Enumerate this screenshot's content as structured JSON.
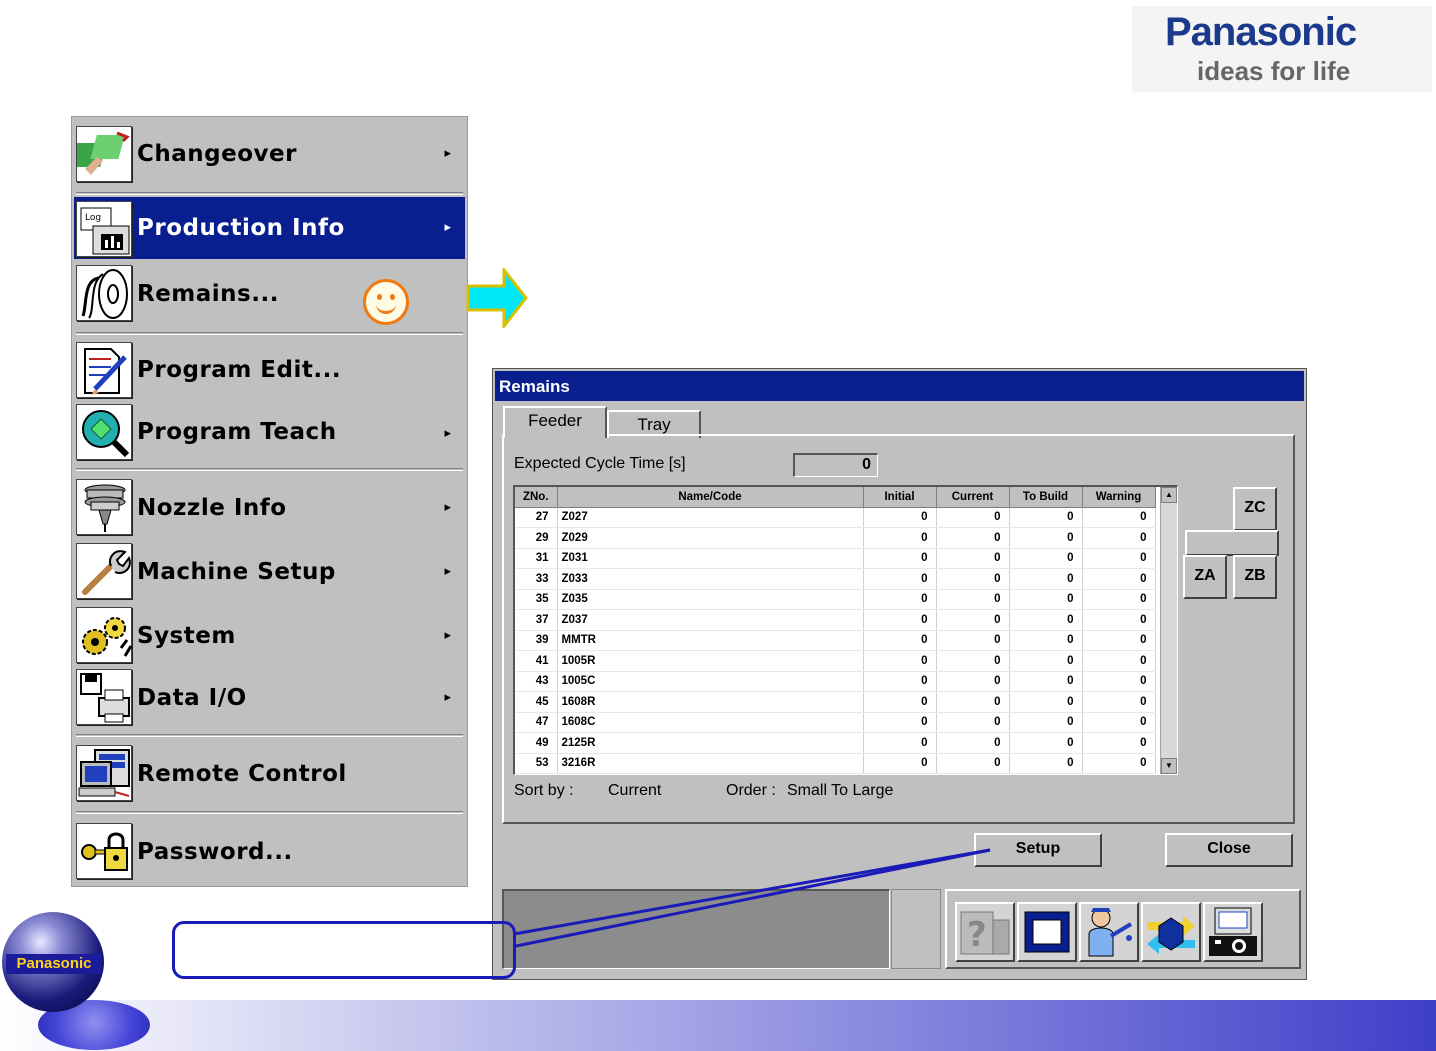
{
  "brand": {
    "name": "Panasonic",
    "tagline": "ideas for life"
  },
  "menu": {
    "items": [
      {
        "label": "Changeover",
        "icon": "changeover-icon",
        "arrow": "▸"
      },
      {
        "label": "Production Info",
        "icon": "log-chart-icon",
        "arrow": "▸"
      },
      {
        "label": "Remains...",
        "icon": "reel-icon",
        "arrow": ""
      },
      {
        "label": "Program Edit...",
        "icon": "document-pen-icon",
        "arrow": ""
      },
      {
        "label": "Program Teach",
        "icon": "magnifier-icon",
        "arrow": "▸"
      },
      {
        "label": "Nozzle Info",
        "icon": "nozzle-icon",
        "arrow": "▸"
      },
      {
        "label": "Machine Setup",
        "icon": "wrench-icon",
        "arrow": "▸"
      },
      {
        "label": "System",
        "icon": "gears-icon",
        "arrow": "▸"
      },
      {
        "label": "Data I/O",
        "icon": "floppy-printer-icon",
        "arrow": "▸"
      },
      {
        "label": "Remote Control",
        "icon": "computer-icon",
        "arrow": ""
      },
      {
        "label": "Password...",
        "icon": "key-lock-icon",
        "arrow": ""
      }
    ],
    "active_index": 1
  },
  "dialog": {
    "title": "Remains",
    "tabs": [
      "Feeder",
      "Tray"
    ],
    "active_tab": "Feeder",
    "expected_cycle_label": "Expected Cycle Time [s]",
    "expected_cycle_value": "0",
    "table": {
      "headers": [
        "ZNo.",
        "Name/Code",
        "Initial",
        "Current",
        "To Build",
        "Warning"
      ],
      "rows": [
        [
          "27",
          "Z027",
          "0",
          "0",
          "0",
          "0"
        ],
        [
          "29",
          "Z029",
          "0",
          "0",
          "0",
          "0"
        ],
        [
          "31",
          "Z031",
          "0",
          "0",
          "0",
          "0"
        ],
        [
          "33",
          "Z033",
          "0",
          "0",
          "0",
          "0"
        ],
        [
          "35",
          "Z035",
          "0",
          "0",
          "0",
          "0"
        ],
        [
          "37",
          "Z037",
          "0",
          "0",
          "0",
          "0"
        ],
        [
          "39",
          "MMTR",
          "0",
          "0",
          "0",
          "0"
        ],
        [
          "41",
          "1005R",
          "0",
          "0",
          "0",
          "0"
        ],
        [
          "43",
          "1005C",
          "0",
          "0",
          "0",
          "0"
        ],
        [
          "45",
          "1608R",
          "0",
          "0",
          "0",
          "0"
        ],
        [
          "47",
          "1608C",
          "0",
          "0",
          "0",
          "0"
        ],
        [
          "49",
          "2125R",
          "0",
          "0",
          "0",
          "0"
        ],
        [
          "53",
          "3216R",
          "0",
          "0",
          "0",
          "0"
        ]
      ]
    },
    "sort_by_label": "Sort by :",
    "sort_by_value": "Current",
    "order_label": "Order :",
    "order_value": "Small To Large",
    "zone_buttons": {
      "zc": "ZC",
      "za": "ZA",
      "zb": "ZB"
    },
    "setup_label": "Setup",
    "close_label": "Close",
    "toolbar_icons": [
      "help-icon",
      "screen-icon",
      "operator-icon",
      "transfer-icon",
      "camera-icon"
    ]
  },
  "colors": {
    "title_bar": "#0a1f8f",
    "callout": "#1a1ab8",
    "smiley": "#f07a10",
    "arrow": "#00e8f8"
  },
  "footer": {
    "globe_label": "Panasonic"
  }
}
